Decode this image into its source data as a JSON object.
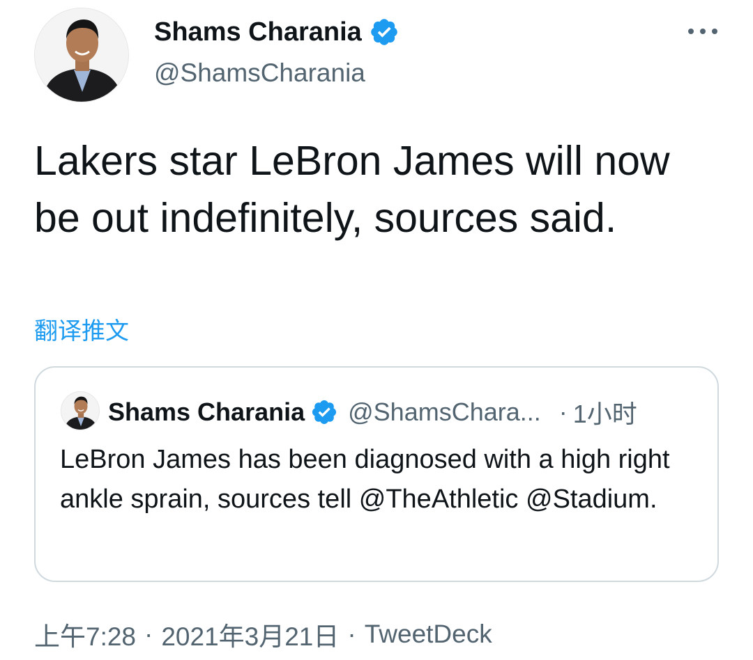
{
  "tweet": {
    "author": {
      "name": "Shams Charania",
      "handle": "@ShamsCharania",
      "avatar_icon": "profile-photo",
      "verified_icon": "verified-badge-icon"
    },
    "more_icon": "more-options-icon",
    "text": "Lakers star LeBron James will now be out indefinitely, sources said.",
    "translate_label": "翻译推文",
    "quoted_tweet": {
      "name": "Shams Charania",
      "handle": "@ShamsChara...",
      "separator": "·",
      "time": "1小时",
      "text": "LeBron James has been diagnosed with a high right ankle sprain, sources tell @TheAthletic @Stadium."
    },
    "meta": {
      "time": "上午7:28",
      "sep1": "·",
      "date": "2021年3月21日",
      "sep2": "·",
      "source": "TweetDeck"
    }
  },
  "colors": {
    "text_primary": "#0f1419",
    "text_secondary": "#536471",
    "accent": "#1d9bf0",
    "border": "#cfd9de"
  }
}
